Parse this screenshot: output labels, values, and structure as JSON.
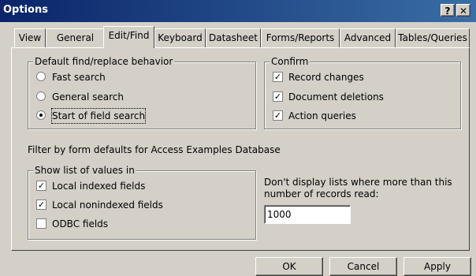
{
  "window": {
    "title": "Options",
    "help_label": "?",
    "close_label": "✕"
  },
  "tabs": [
    {
      "label": "View"
    },
    {
      "label": "General"
    },
    {
      "label": "Edit/Find",
      "active": true
    },
    {
      "label": "Keyboard"
    },
    {
      "label": "Datasheet"
    },
    {
      "label": "Forms/Reports"
    },
    {
      "label": "Advanced"
    },
    {
      "label": "Tables/Queries"
    }
  ],
  "find_replace": {
    "label": "Default find/replace behavior",
    "options": [
      {
        "label": "Fast search",
        "selected": false
      },
      {
        "label": "General search",
        "selected": false
      },
      {
        "label": "Start of field search",
        "selected": true
      }
    ]
  },
  "confirm": {
    "label": "Confirm",
    "options": [
      {
        "label": "Record changes",
        "checked": true
      },
      {
        "label": "Document deletions",
        "checked": true
      },
      {
        "label": "Action queries",
        "checked": true
      }
    ]
  },
  "filter_heading": "Filter by form defaults for Access Examples Database",
  "show_list": {
    "label": "Show list of values in",
    "options": [
      {
        "label": "Local indexed fields",
        "checked": true
      },
      {
        "label": "Local nonindexed fields",
        "checked": true
      },
      {
        "label": "ODBC fields",
        "checked": false
      }
    ]
  },
  "records_limit": {
    "label_line1": "Don't display lists where more than this",
    "label_line2": "number of records read:",
    "value": "1000"
  },
  "buttons": {
    "ok": "OK",
    "cancel": "Cancel",
    "apply": "Apply"
  }
}
